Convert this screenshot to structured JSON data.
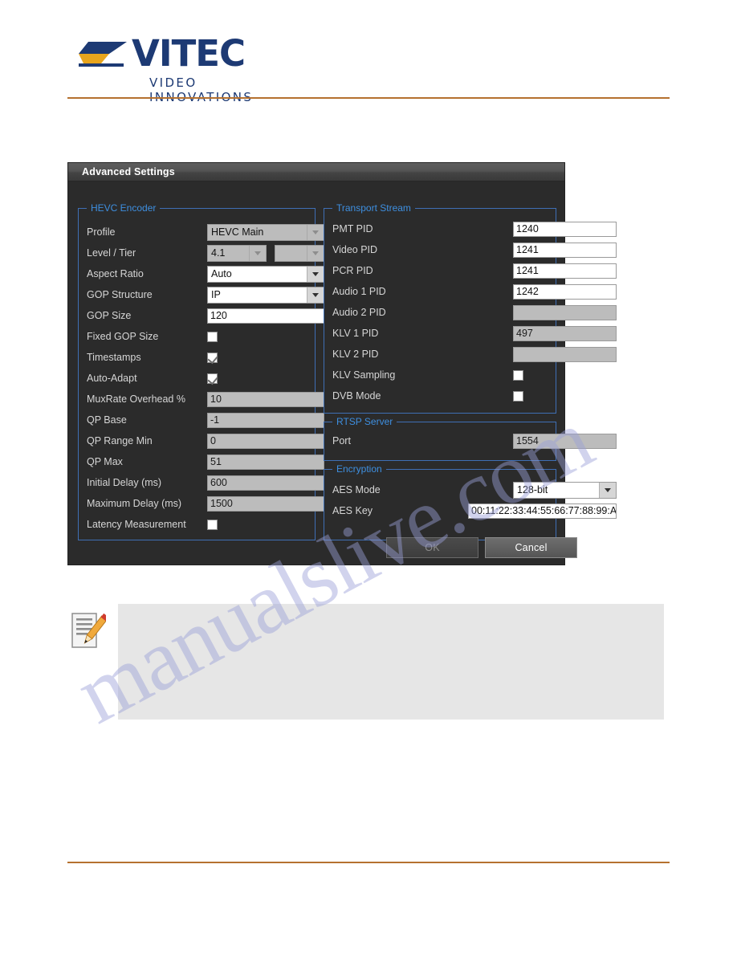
{
  "page": {
    "watermark_text": "manualslive.com",
    "rule_color": "#b5712f"
  },
  "brand": {
    "name": "VITEC",
    "tagline": "VIDEO INNOVATIONS",
    "logo_icon": "vitec-swoosh-logo",
    "color_navy": "#1d3a74",
    "color_gold": "#e8a51d"
  },
  "dialog": {
    "title": "Advanced Settings",
    "accent_color": "#3e8fe0",
    "groups": {
      "hevc": {
        "legend": "HEVC Encoder",
        "rows": [
          {
            "label": "Profile",
            "type": "combo",
            "value": "HEVC Main",
            "state": "disabled"
          },
          {
            "label": "Level / Tier",
            "type": "combo2",
            "value": "4.1",
            "value2": "",
            "state": "disabled"
          },
          {
            "label": "Aspect Ratio",
            "type": "combo",
            "value": "Auto",
            "state": "enabled"
          },
          {
            "label": "GOP Structure",
            "type": "combo",
            "value": "IP",
            "state": "enabled"
          },
          {
            "label": "GOP Size",
            "type": "text",
            "value": "120",
            "state": "enabled"
          },
          {
            "label": "Fixed GOP Size",
            "type": "checkbox",
            "checked": false
          },
          {
            "label": "Timestamps",
            "type": "checkbox",
            "checked": true
          },
          {
            "label": "Auto-Adapt",
            "type": "checkbox",
            "checked": true
          },
          {
            "label": "MuxRate Overhead %",
            "type": "text",
            "value": "10",
            "state": "disabled"
          },
          {
            "label": "QP Base",
            "type": "text",
            "value": "-1",
            "state": "disabled"
          },
          {
            "label": "QP Range Min",
            "type": "text",
            "value": "0",
            "state": "disabled"
          },
          {
            "label": "QP Max",
            "type": "text",
            "value": "51",
            "state": "disabled"
          },
          {
            "label": "Initial Delay (ms)",
            "type": "text",
            "value": "600",
            "state": "disabled"
          },
          {
            "label": "Maximum Delay (ms)",
            "type": "text",
            "value": "1500",
            "state": "disabled"
          },
          {
            "label": "Latency Measurement",
            "type": "checkbox",
            "checked": false
          }
        ]
      },
      "transport_stream": {
        "legend": "Transport Stream",
        "rows": [
          {
            "label": "PMT PID",
            "type": "text",
            "value": "1240",
            "state": "enabled"
          },
          {
            "label": "Video PID",
            "type": "text",
            "value": "1241",
            "state": "enabled"
          },
          {
            "label": "PCR PID",
            "type": "text",
            "value": "1241",
            "state": "enabled"
          },
          {
            "label": "Audio 1 PID",
            "type": "text",
            "value": "1242",
            "state": "enabled"
          },
          {
            "label": "Audio 2 PID",
            "type": "text",
            "value": "",
            "state": "disabled"
          },
          {
            "label": "KLV 1 PID",
            "type": "text",
            "value": "497",
            "state": "disabled"
          },
          {
            "label": "KLV 2 PID",
            "type": "text",
            "value": "",
            "state": "disabled"
          },
          {
            "label": "KLV Sampling",
            "type": "checkbox",
            "checked": false
          },
          {
            "label": "DVB Mode",
            "type": "checkbox",
            "checked": false
          }
        ]
      },
      "rtsp_server": {
        "legend": "RTSP Server",
        "rows": [
          {
            "label": "Port",
            "type": "text",
            "value": "1554",
            "state": "disabled"
          }
        ]
      },
      "encryption": {
        "legend": "Encryption",
        "rows": [
          {
            "label": "AES Mode",
            "type": "combo",
            "value": "128-bit",
            "state": "enabled"
          },
          {
            "label": "AES Key",
            "type": "text",
            "value": "00:11:22:33:44:55:66:77:88:99:A",
            "state": "enabled"
          }
        ]
      }
    },
    "buttons": {
      "ok": {
        "label": "OK",
        "state": "disabled"
      },
      "cancel": {
        "label": "Cancel",
        "state": "enabled"
      }
    }
  },
  "note": {
    "icon": "note-pencil-icon",
    "body": ""
  }
}
